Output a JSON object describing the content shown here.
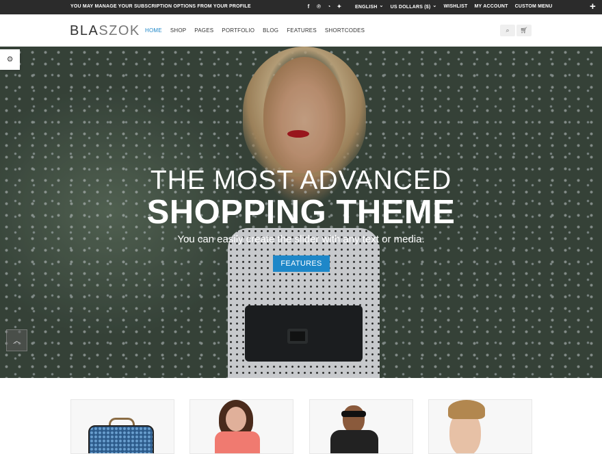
{
  "topbar": {
    "notice": "YOU MAY MANAGE YOUR SUBSCRIPTION OPTIONS FROM YOUR PROFILE",
    "social_icons": [
      "facebook-icon",
      "pinterest-icon",
      "rss-icon",
      "twitter-icon"
    ],
    "language": "ENGLISH",
    "currency": "US DOLLARS ($)",
    "wishlist": "WISHLIST",
    "my_account": "MY ACCOUNT",
    "custom_menu": "CUSTOM MENU",
    "plus_icon": "+"
  },
  "header": {
    "logo_dark": "BLA",
    "logo_light": "SZOK",
    "nav": [
      "HOME",
      "SHOP",
      "PAGES",
      "PORTFOLIO",
      "BLOG",
      "FEATURES",
      "SHORTCODES"
    ],
    "active_nav": "HOME",
    "search_icon": "search-icon",
    "cart_icon": "cart-icon"
  },
  "hero": {
    "title_line1": "THE MOST ADVANCED",
    "title_line2": "SHOPPING THEME",
    "subtitle": "You can easily create the slider with any text or media.",
    "cta_label": "FEATURES"
  },
  "colors": {
    "accent": "#1e87c8",
    "topbar_bg": "#2b2b2b"
  },
  "products": [
    {
      "icon": "purse-image"
    },
    {
      "icon": "woman-model-image"
    },
    {
      "icon": "man-sunglasses-image"
    },
    {
      "icon": "man-portrait-image"
    }
  ]
}
